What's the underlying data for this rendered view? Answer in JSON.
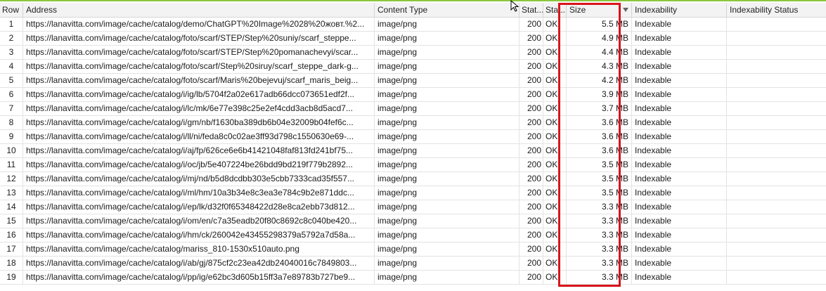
{
  "table": {
    "columns": [
      {
        "key": "row",
        "label": "Row"
      },
      {
        "key": "address",
        "label": "Address"
      },
      {
        "key": "content_type",
        "label": "Content Type"
      },
      {
        "key": "status_code",
        "label": "Stat..."
      },
      {
        "key": "status",
        "label": "Stat..."
      },
      {
        "key": "size",
        "label": "Size",
        "sorted": "descending"
      },
      {
        "key": "indexability",
        "label": "Indexability"
      },
      {
        "key": "indexability_status",
        "label": "Indexability Status"
      }
    ],
    "rows": [
      {
        "row": "1",
        "address": "https://lanavitta.com/image/cache/catalog/demo/ChatGPT%20Image%2028%20жовт.%2...",
        "content_type": "image/png",
        "status_code": "200",
        "status": "OK",
        "size": "5.5 MB",
        "indexability": "Indexable",
        "indexability_status": ""
      },
      {
        "row": "2",
        "address": "https://lanavitta.com/image/cache/catalog/foto/scarf/STEP/Step%20suniy/scarf_steppe...",
        "content_type": "image/png",
        "status_code": "200",
        "status": "OK",
        "size": "4.9 MB",
        "indexability": "Indexable",
        "indexability_status": ""
      },
      {
        "row": "3",
        "address": "https://lanavitta.com/image/cache/catalog/foto/scarf/STEP/Step%20pomanachevyi/scar...",
        "content_type": "image/png",
        "status_code": "200",
        "status": "OK",
        "size": "4.4 MB",
        "indexability": "Indexable",
        "indexability_status": ""
      },
      {
        "row": "4",
        "address": "https://lanavitta.com/image/cache/catalog/foto/scarf/Step%20siruy/scarf_steppe_dark-g...",
        "content_type": "image/png",
        "status_code": "200",
        "status": "OK",
        "size": "4.3 MB",
        "indexability": "Indexable",
        "indexability_status": ""
      },
      {
        "row": "5",
        "address": "https://lanavitta.com/image/cache/catalog/foto/scarf/Maris%20bejevuj/scarf_maris_beig...",
        "content_type": "image/png",
        "status_code": "200",
        "status": "OK",
        "size": "4.2 MB",
        "indexability": "Indexable",
        "indexability_status": ""
      },
      {
        "row": "6",
        "address": "https://lanavitta.com/image/cache/catalog/i/ig/lb/5704f2a02e617adb66dcc073651edf2f...",
        "content_type": "image/png",
        "status_code": "200",
        "status": "OK",
        "size": "3.9 MB",
        "indexability": "Indexable",
        "indexability_status": ""
      },
      {
        "row": "7",
        "address": "https://lanavitta.com/image/cache/catalog/i/lc/mk/6e77e398c25e2ef4cdd3acb8d5acd7...",
        "content_type": "image/png",
        "status_code": "200",
        "status": "OK",
        "size": "3.7 MB",
        "indexability": "Indexable",
        "indexability_status": ""
      },
      {
        "row": "8",
        "address": "https://lanavitta.com/image/cache/catalog/i/gm/nb/f1630ba389db6b04e32009b04fef6c...",
        "content_type": "image/png",
        "status_code": "200",
        "status": "OK",
        "size": "3.6 MB",
        "indexability": "Indexable",
        "indexability_status": ""
      },
      {
        "row": "9",
        "address": "https://lanavitta.com/image/cache/catalog/i/ll/ni/feda8c0c02ae3ff93d798c1550630e69-...",
        "content_type": "image/png",
        "status_code": "200",
        "status": "OK",
        "size": "3.6 MB",
        "indexability": "Indexable",
        "indexability_status": ""
      },
      {
        "row": "10",
        "address": "https://lanavitta.com/image/cache/catalog/i/aj/fp/626ce6e6b41421048faf813fd241bf75...",
        "content_type": "image/png",
        "status_code": "200",
        "status": "OK",
        "size": "3.6 MB",
        "indexability": "Indexable",
        "indexability_status": ""
      },
      {
        "row": "11",
        "address": "https://lanavitta.com/image/cache/catalog/i/oc/jb/5e407224be26bdd9bd219f779b2892...",
        "content_type": "image/png",
        "status_code": "200",
        "status": "OK",
        "size": "3.5 MB",
        "indexability": "Indexable",
        "indexability_status": ""
      },
      {
        "row": "12",
        "address": "https://lanavitta.com/image/cache/catalog/i/mj/nd/b5d8dcdbb303e5cbb7333cad35f557...",
        "content_type": "image/png",
        "status_code": "200",
        "status": "OK",
        "size": "3.5 MB",
        "indexability": "Indexable",
        "indexability_status": ""
      },
      {
        "row": "13",
        "address": "https://lanavitta.com/image/cache/catalog/i/ml/hm/10a3b34e8c3ea3e784c9b2e871ddc...",
        "content_type": "image/png",
        "status_code": "200",
        "status": "OK",
        "size": "3.5 MB",
        "indexability": "Indexable",
        "indexability_status": ""
      },
      {
        "row": "14",
        "address": "https://lanavitta.com/image/cache/catalog/i/ep/lk/d32f0f65348422d28e8ca2ebb73d812...",
        "content_type": "image/png",
        "status_code": "200",
        "status": "OK",
        "size": "3.3 MB",
        "indexability": "Indexable",
        "indexability_status": ""
      },
      {
        "row": "15",
        "address": "https://lanavitta.com/image/cache/catalog/i/om/en/c7a35eadb20f80c8692c8c040be420...",
        "content_type": "image/png",
        "status_code": "200",
        "status": "OK",
        "size": "3.3 MB",
        "indexability": "Indexable",
        "indexability_status": ""
      },
      {
        "row": "16",
        "address": "https://lanavitta.com/image/cache/catalog/i/hm/ck/260042e43455298379a5792a7d58a...",
        "content_type": "image/png",
        "status_code": "200",
        "status": "OK",
        "size": "3.3 MB",
        "indexability": "Indexable",
        "indexability_status": ""
      },
      {
        "row": "17",
        "address": "https://lanavitta.com/image/cache/catalog/mariss_810-1530x510auto.png",
        "content_type": "image/png",
        "status_code": "200",
        "status": "OK",
        "size": "3.3 MB",
        "indexability": "Indexable",
        "indexability_status": ""
      },
      {
        "row": "18",
        "address": "https://lanavitta.com/image/cache/catalog/i/ab/gj/875cf2c23ea42db24040016c7849803...",
        "content_type": "image/png",
        "status_code": "200",
        "status": "OK",
        "size": "3.3 MB",
        "indexability": "Indexable",
        "indexability_status": ""
      },
      {
        "row": "19",
        "address": "https://lanavitta.com/image/cache/catalog/i/pp/ig/e62bc3d605b15ff3a7e89783b727be9...",
        "content_type": "image/png",
        "status_code": "200",
        "status": "OK",
        "size": "3.3 MB",
        "indexability": "Indexable",
        "indexability_status": ""
      }
    ]
  },
  "highlight": {
    "column": "size",
    "color": "#d9141b"
  },
  "accent_color": "#8cc63f",
  "icons": {
    "sort": "sort-descending-icon",
    "cursor": "mouse-pointer-icon"
  }
}
